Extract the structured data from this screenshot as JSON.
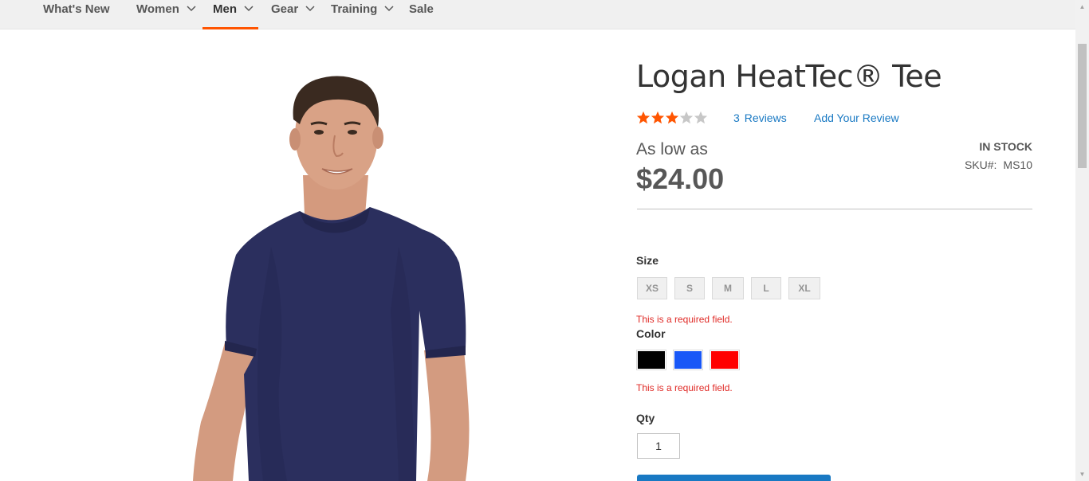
{
  "nav": {
    "items": [
      {
        "label": "What's New",
        "has_dropdown": false,
        "active": false
      },
      {
        "label": "Women",
        "has_dropdown": true,
        "active": false
      },
      {
        "label": "Men",
        "has_dropdown": true,
        "active": true
      },
      {
        "label": "Gear",
        "has_dropdown": true,
        "active": false
      },
      {
        "label": "Training",
        "has_dropdown": true,
        "active": false
      },
      {
        "label": "Sale",
        "has_dropdown": false,
        "active": false
      }
    ]
  },
  "product": {
    "title": "Logan HeatTec® Tee",
    "rating": {
      "filled": 3,
      "out_of": 5
    },
    "reviews_count": "3",
    "reviews_label": "Reviews",
    "add_review_label": "Add Your Review",
    "price_prefix": "As low as",
    "price": "$24.00",
    "stock_status": "IN STOCK",
    "sku_label": "SKU#:",
    "sku": "MS10",
    "image_icon": "man-in-navy-tshirt-image"
  },
  "options": {
    "size": {
      "label": "Size",
      "values": [
        "XS",
        "S",
        "M",
        "L",
        "XL"
      ],
      "error": "This is a required field."
    },
    "color": {
      "label": "Color",
      "values": [
        {
          "name": "Black",
          "hex": "#000000"
        },
        {
          "name": "Blue",
          "hex": "#1857f7"
        },
        {
          "name": "Red",
          "hex": "#ff0000"
        }
      ],
      "error": "This is a required field."
    }
  },
  "qty": {
    "label": "Qty",
    "value": "1"
  },
  "colors": {
    "accent": "#ff5501",
    "link": "#1979c3",
    "error": "#e02b27",
    "star_filled": "#ff5501",
    "star_empty": "#c7c7c7"
  }
}
